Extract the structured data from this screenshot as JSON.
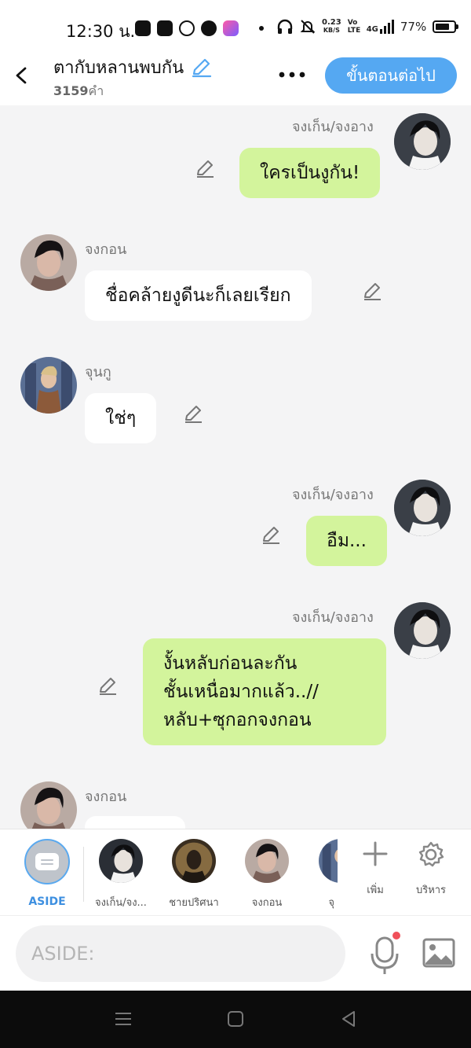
{
  "status_bar": {
    "time": "12:30 น.",
    "speed_value": "0.23",
    "speed_unit": "KB/S",
    "volte": "Vo LTE",
    "network": "4G",
    "battery": "77%",
    "battery_level": 0.77
  },
  "header": {
    "title": "ตากับหลานพบกัน",
    "word_count_num": "3159",
    "word_count_unit": "คำ",
    "next_button": "ขั้นตอนต่อไป",
    "accent_color": "#55a8f2"
  },
  "messages": [
    {
      "sender": "จงเก็น/จงอาง",
      "text": "ใครเป็นงูกัน!",
      "mine": true
    },
    {
      "sender": "จงกอน",
      "text": "ชื่อคล้ายงูดีนะก็เลยเรียก",
      "mine": false
    },
    {
      "sender": "จุนกู",
      "text": "ใช่ๆ",
      "mine": false
    },
    {
      "sender": "จงเก็น/จงอาง",
      "text": "อืม...",
      "mine": true
    },
    {
      "sender": "จงเก็น/จงอาง",
      "lines": [
        "งั้นหลับก่อนละกัน",
        "ชั้นเหนื่อมากแล้ว..//",
        "หลับ+ซุกอกจงกอน"
      ],
      "mine": true
    },
    {
      "sender": "จงกอน",
      "text": "",
      "mine": false
    }
  ],
  "characters": [
    {
      "label": "ASIDE"
    },
    {
      "label": "จงเก็น/จง..."
    },
    {
      "label": "ชายปริศนา"
    },
    {
      "label": "จงกอน"
    },
    {
      "label": "จุ"
    }
  ],
  "tools": {
    "add_label": "เพิ่ม",
    "manage_label": "บริหาร"
  },
  "input": {
    "placeholder": "ASIDE:"
  },
  "colors": {
    "my_bubble": "#d3f49c",
    "their_bubble": "#ffffff",
    "background": "#f4f4f5"
  }
}
